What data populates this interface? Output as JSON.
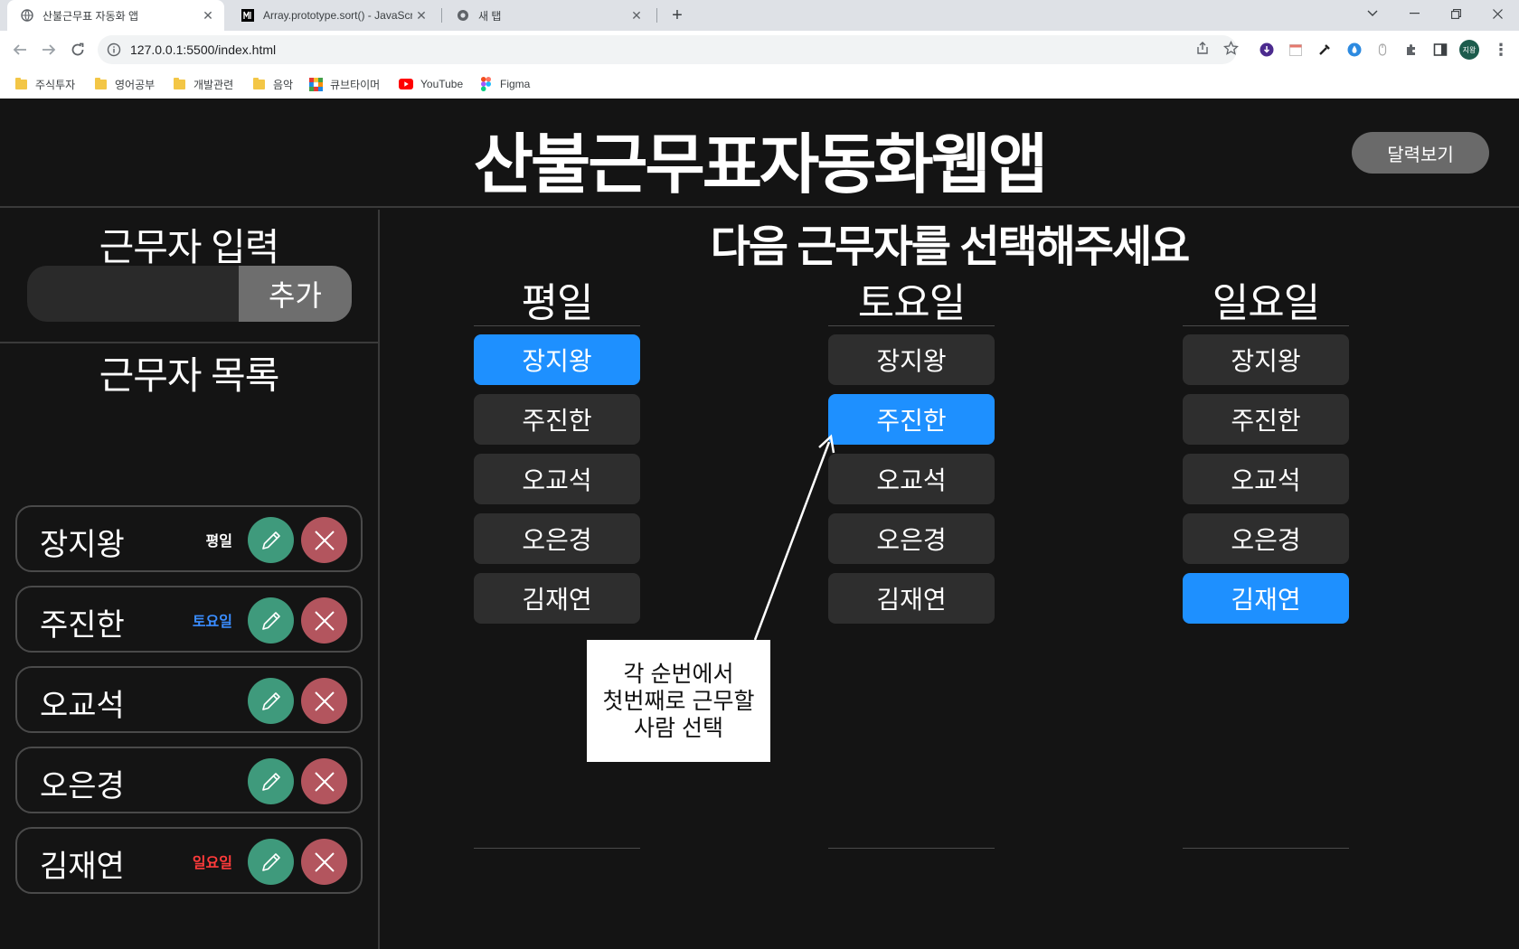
{
  "browser": {
    "tabs": [
      {
        "title": "산불근무표 자동화 앱",
        "active": true
      },
      {
        "title": "Array.prototype.sort() - JavaScri",
        "active": false
      },
      {
        "title": "새 탭",
        "active": false
      }
    ],
    "url": "127.0.0.1:5500/index.html",
    "profile_initials": "지왕",
    "bookmarks": [
      "주식투자",
      "영어공부",
      "개발관련",
      "음악",
      "큐브타이머",
      "YouTube",
      "Figma"
    ]
  },
  "app": {
    "title": "산불근무표자동화웹앱",
    "calendar_button": "달력보기",
    "input_section_title": "근무자 입력",
    "input_placeholder": "",
    "add_button": "추가",
    "list_section_title": "근무자 목록",
    "workers": [
      {
        "name": "장지왕",
        "tag": "평일",
        "tag_color": "#ffffff"
      },
      {
        "name": "주진한",
        "tag": "토요일",
        "tag_color": "#3a8dff"
      },
      {
        "name": "오교석",
        "tag": "",
        "tag_color": "#ffffff"
      },
      {
        "name": "오은경",
        "tag": "",
        "tag_color": "#ffffff"
      },
      {
        "name": "김재연",
        "tag": "일요일",
        "tag_color": "#ff3b3b"
      }
    ],
    "select_title": "다음 근무자를 선택해주세요",
    "columns": [
      {
        "title": "평일",
        "options": [
          "장지왕",
          "주진한",
          "오교석",
          "오은경",
          "김재연"
        ],
        "selected": "장지왕"
      },
      {
        "title": "토요일",
        "options": [
          "장지왕",
          "주진한",
          "오교석",
          "오은경",
          "김재연"
        ],
        "selected": "주진한"
      },
      {
        "title": "일요일",
        "options": [
          "장지왕",
          "주진한",
          "오교석",
          "오은경",
          "김재연"
        ],
        "selected": "김재연"
      }
    ],
    "annotation_lines": [
      "각 순번에서",
      "첫번째로 근무할",
      "사람 선택"
    ],
    "colors": {
      "accent": "#1e90ff",
      "edit": "#3f9a7c",
      "delete": "#b3555e",
      "background": "#141414"
    }
  }
}
